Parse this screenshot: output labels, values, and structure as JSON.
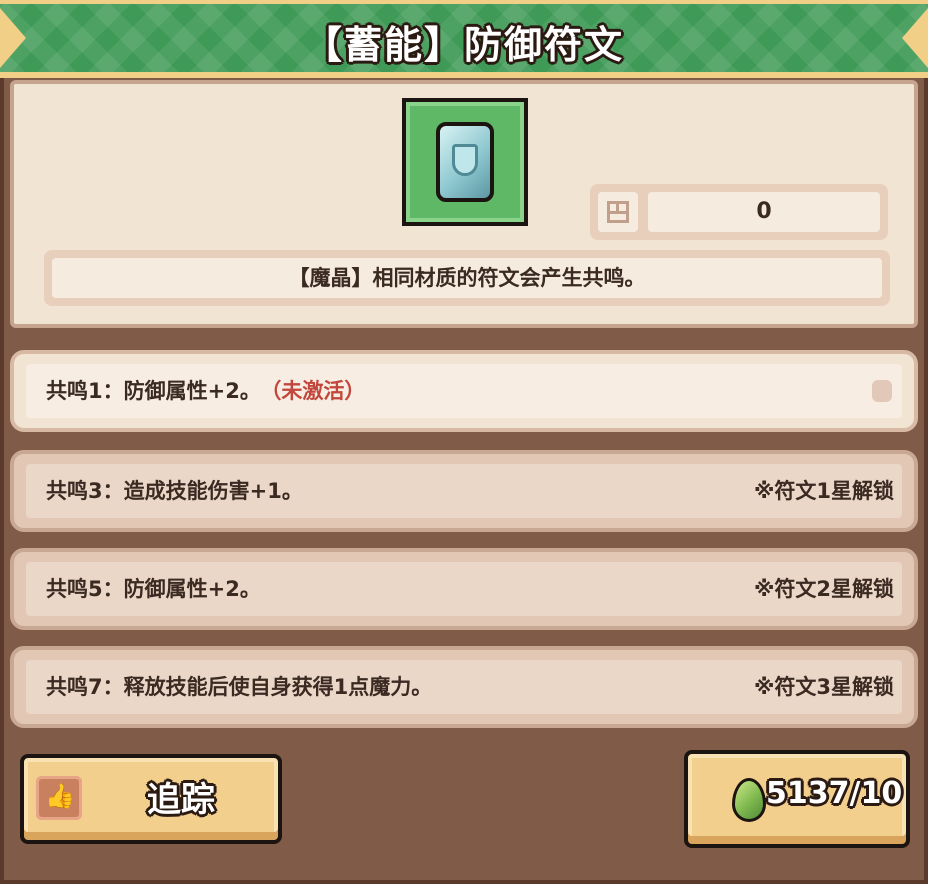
{
  "title": "【蓄能】防御符文",
  "rune": {
    "icon": "shield-rune-icon",
    "count": "0",
    "description": "【魔晶】相同材质的符文会产生共鸣。"
  },
  "resonances": [
    {
      "text": "共鸣1：防御属性+2。",
      "status": "（未激活）",
      "unlock": ""
    },
    {
      "text": "共鸣3：造成技能伤害+1。",
      "status": "",
      "unlock": "※符文1星解锁"
    },
    {
      "text": "共鸣5：防御属性+2。",
      "status": "",
      "unlock": "※符文2星解锁"
    },
    {
      "text": "共鸣7：释放技能后使自身获得1点魔力。",
      "status": "",
      "unlock": "※符文3星解锁"
    }
  ],
  "buttons": {
    "track_label": "追踪",
    "cost_label": "5137/10"
  },
  "colors": {
    "banner": "#3e9a56",
    "inactive_status": "#c2463c",
    "button": "#f3cf8e"
  }
}
